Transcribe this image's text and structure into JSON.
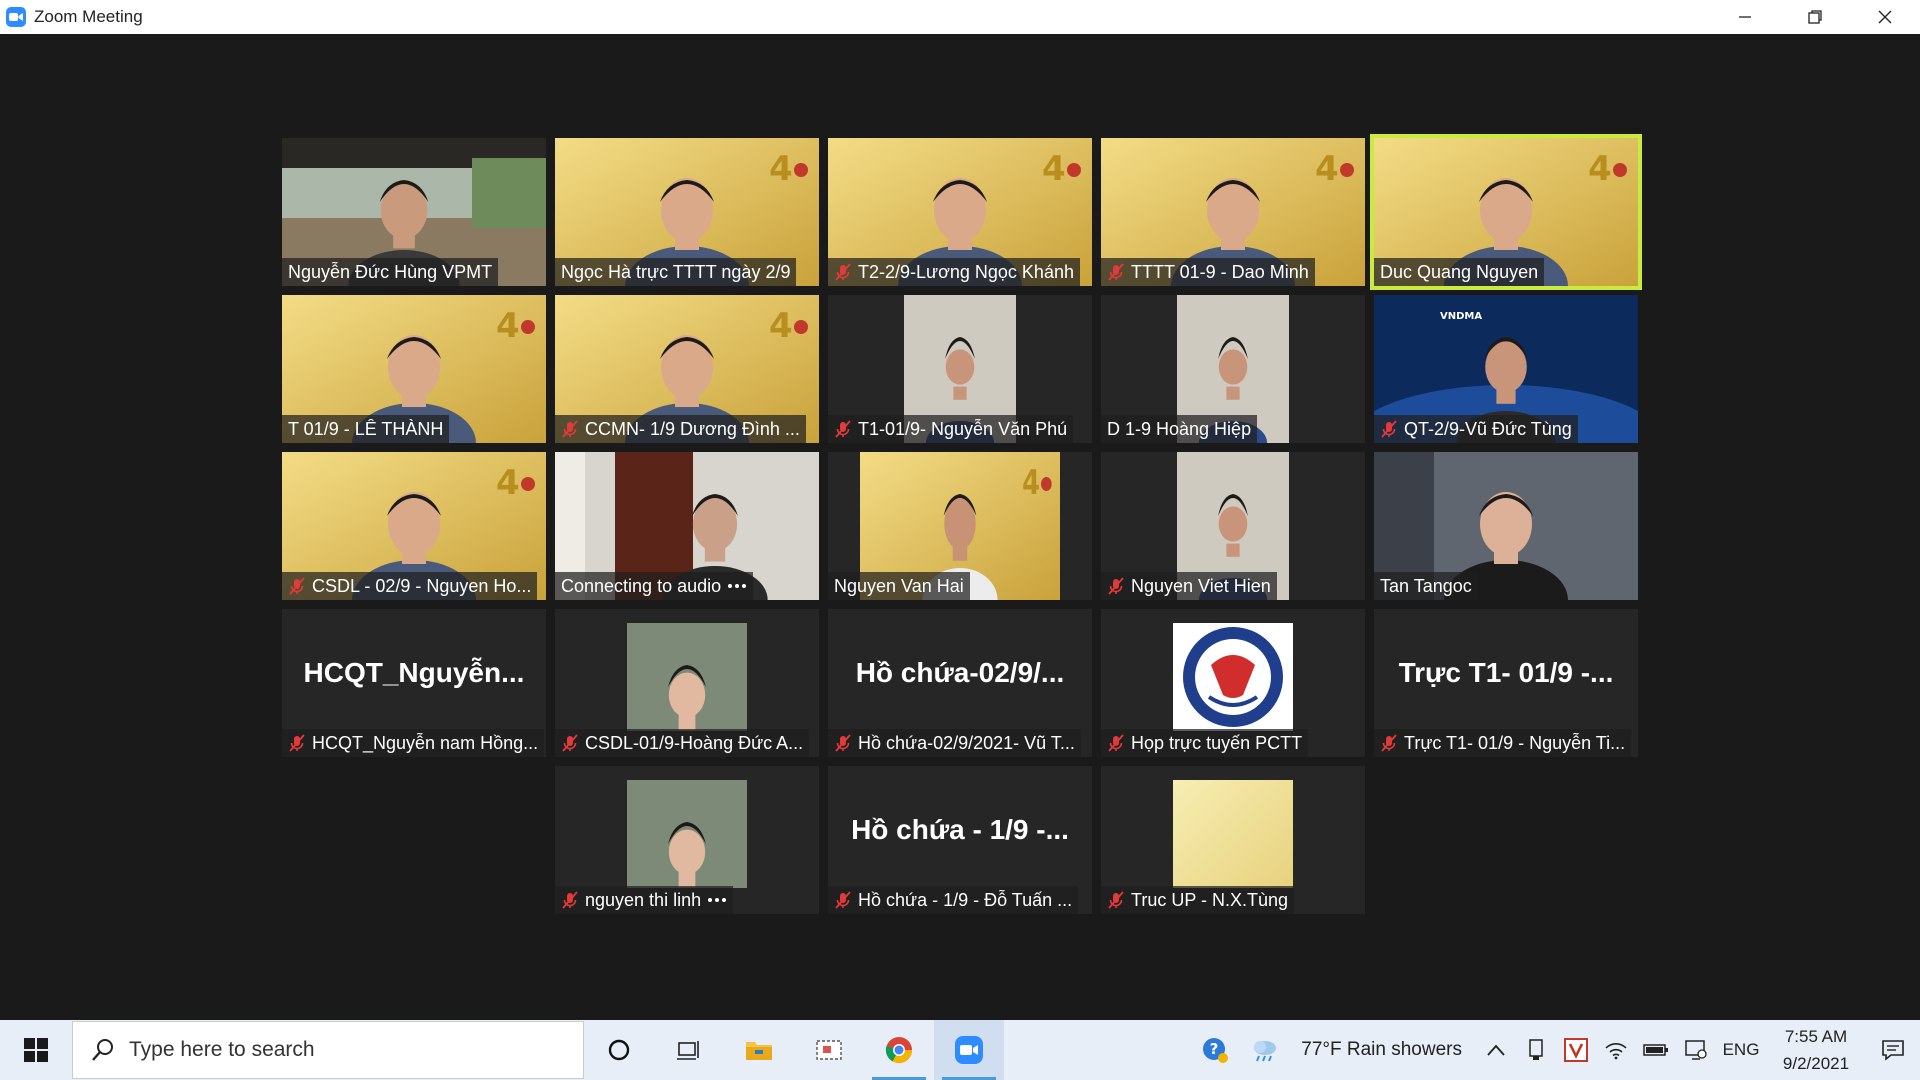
{
  "window": {
    "title": "Zoom Meeting"
  },
  "colors": {
    "active_speaker": "#c9ea3e",
    "tile_bg": "#262626",
    "gold_bg": "#e4c55a",
    "zoom_blue": "#2d8cff"
  },
  "participants": [
    {
      "name": "Nguyễn Đức Hùng  VPMT",
      "muted": false,
      "video": "outdoor"
    },
    {
      "name": "Ngọc Hà trực TTTT ngày 2/9",
      "muted": false,
      "video": "gold"
    },
    {
      "name": "T2-2/9-Lương Ngọc Khánh",
      "muted": true,
      "video": "gold"
    },
    {
      "name": "TTTT 01-9 - Dao Minh",
      "muted": true,
      "video": "gold"
    },
    {
      "name": "Duc Quang Nguyen",
      "muted": false,
      "video": "gold",
      "active": true
    },
    {
      "name": "T 01/9 - LÊ THÀNH",
      "muted": false,
      "video": "gold"
    },
    {
      "name": "CCMN- 1/9 Dương Đình ...",
      "muted": true,
      "video": "gold"
    },
    {
      "name": "T1-01/9- Nguyễn Văn Phú",
      "muted": true,
      "video": "room-narrow"
    },
    {
      "name": "D 1-9 Hoàng Hiệp",
      "muted": false,
      "video": "room-narrow"
    },
    {
      "name": "QT-2/9-Vũ Đức Tùng",
      "muted": true,
      "video": "blue",
      "banner": "VNDMA"
    },
    {
      "name": "CSDL - 02/9 - Nguyen Ho...",
      "muted": true,
      "video": "gold"
    },
    {
      "name": "Connecting to audio",
      "muted": false,
      "video": "room",
      "connecting": true
    },
    {
      "name": "Nguyen Van Hai",
      "muted": false,
      "video": "gold-narrow"
    },
    {
      "name": "Nguyen Viet Hien",
      "muted": true,
      "video": "room-narrow"
    },
    {
      "name": "Tan Tangoc",
      "muted": false,
      "video": "dark"
    },
    {
      "name": "HCQT_Nguyễn nam Hồng...",
      "muted": true,
      "video": "none",
      "display": "HCQT_Nguyễn..."
    },
    {
      "name": "CSDL-01/9-Hoàng Đức A...",
      "muted": true,
      "video": "avatar"
    },
    {
      "name": "Hồ chứa-02/9/2021- Vũ T...",
      "muted": true,
      "video": "none",
      "display": "Hồ  chứa-02/9/..."
    },
    {
      "name": "Họp trực tuyến PCTT",
      "muted": true,
      "video": "logo"
    },
    {
      "name": "Trực T1- 01/9 - Nguyễn Ti...",
      "muted": true,
      "video": "none",
      "display": "Trực T1- 01/9 -..."
    },
    {
      "name": "nguyen thi linh",
      "muted": true,
      "video": "avatar",
      "more": true
    },
    {
      "name": "Hồ chứa - 1/9 - Đỗ Tuấn ...",
      "muted": true,
      "video": "none",
      "display": "Hồ chứa - 1/9 -..."
    },
    {
      "name": "Truc UP - N.X.Tùng",
      "muted": true,
      "video": "avatar-gold"
    }
  ],
  "taskbar": {
    "search_placeholder": "Type here to search",
    "weather": "77°F  Rain showers",
    "language": "ENG",
    "time": "7:55 AM",
    "date": "9/2/2021"
  }
}
